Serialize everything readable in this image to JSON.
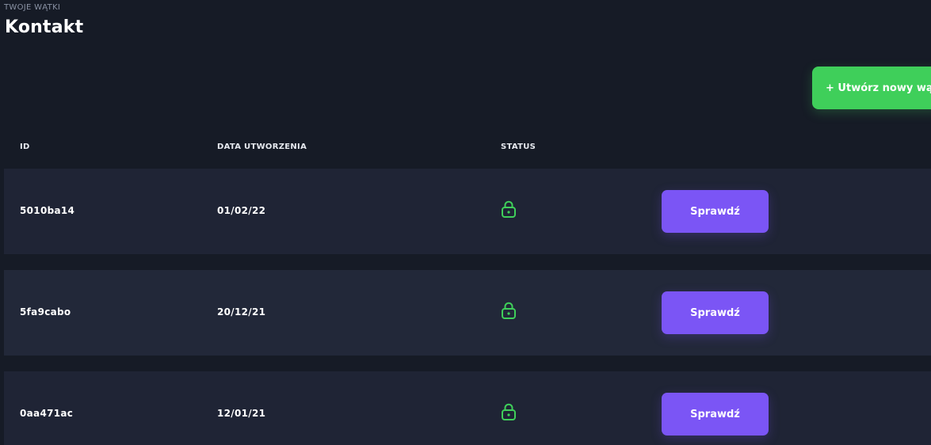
{
  "header": {
    "breadcrumb": "TWOJE WĄTKI",
    "title": "Kontakt",
    "create_button": "+ Utwórz nowy wątek"
  },
  "table": {
    "columns": [
      "ID",
      "DATA UTWORZENIA",
      "STATUS"
    ],
    "rows": [
      {
        "id": "5010ba14",
        "date": "01/02/22",
        "status_icon": "lock-icon",
        "action": "Sprawdź"
      },
      {
        "id": "5fa9cabo",
        "date": "20/12/21",
        "status_icon": "lock-icon",
        "action": "Sprawdź"
      },
      {
        "id": "0aa471ac",
        "date": "12/01/21",
        "status_icon": "lock-icon",
        "action": "Sprawdź"
      }
    ]
  },
  "colors": {
    "background": "#161b26",
    "row_background": "#1f2435",
    "accent_green": "#3fcf5a",
    "accent_purple": "#7b55f5"
  }
}
